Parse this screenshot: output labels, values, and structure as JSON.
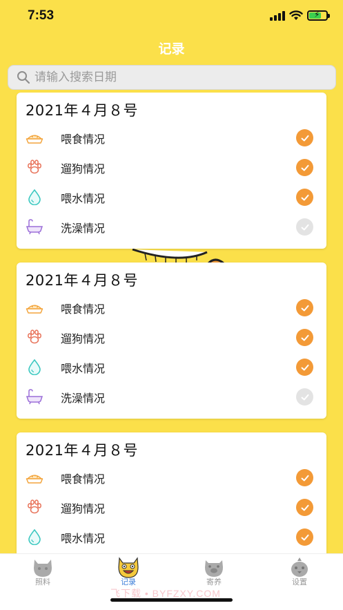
{
  "status_bar": {
    "time": "7:53"
  },
  "nav": {
    "title": "记录"
  },
  "search": {
    "placeholder": "请输入搜索日期"
  },
  "records": [
    {
      "date": "2021年４月８号",
      "items": [
        {
          "icon": "food-bowl-icon",
          "label": "喂食情况",
          "checked": true
        },
        {
          "icon": "paw-icon",
          "label": "遛狗情况",
          "checked": true
        },
        {
          "icon": "water-drop-icon",
          "label": "喂水情况",
          "checked": true
        },
        {
          "icon": "bathtub-icon",
          "label": "洗澡情况",
          "checked": false
        }
      ]
    },
    {
      "date": "2021年４月８号",
      "items": [
        {
          "icon": "food-bowl-icon",
          "label": "喂食情况",
          "checked": true
        },
        {
          "icon": "paw-icon",
          "label": "遛狗情况",
          "checked": true
        },
        {
          "icon": "water-drop-icon",
          "label": "喂水情况",
          "checked": true
        },
        {
          "icon": "bathtub-icon",
          "label": "洗澡情况",
          "checked": false
        }
      ]
    },
    {
      "date": "2021年４月８号",
      "items": [
        {
          "icon": "food-bowl-icon",
          "label": "喂食情况",
          "checked": true
        },
        {
          "icon": "paw-icon",
          "label": "遛狗情况",
          "checked": true
        },
        {
          "icon": "water-drop-icon",
          "label": "喂水情况",
          "checked": true
        }
      ]
    }
  ],
  "tabs": [
    {
      "label": "照料",
      "icon": "cat-face-icon",
      "active": false
    },
    {
      "label": "记录",
      "icon": "cartoon-cat-icon",
      "active": true
    },
    {
      "label": "寄养",
      "icon": "pig-face-icon",
      "active": false
    },
    {
      "label": "设置",
      "icon": "bird-face-icon",
      "active": false
    }
  ],
  "watermark": "飞下载 • BYFZXY.COM",
  "colors": {
    "background": "#fbe04a",
    "check_on": "#f39a37",
    "check_off": "#e3e3e3",
    "tab_active": "#3b7ed8"
  }
}
